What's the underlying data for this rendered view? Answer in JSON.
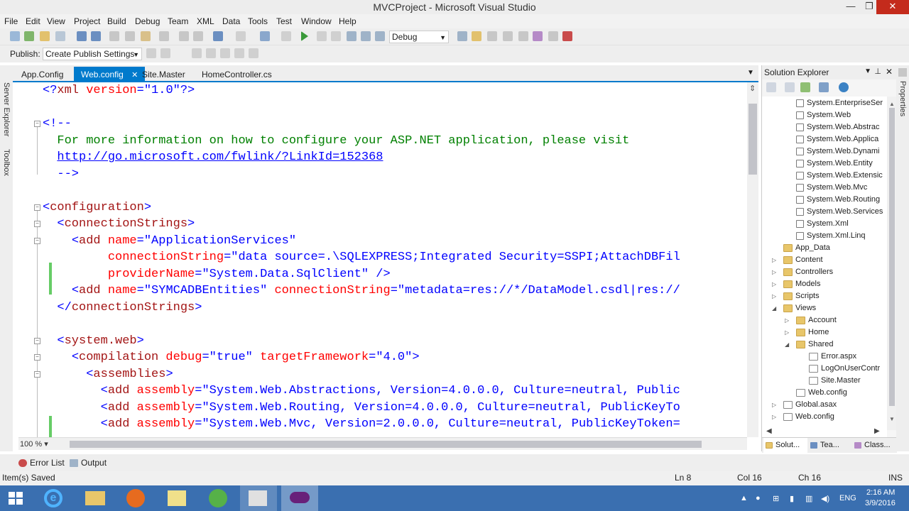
{
  "window": {
    "title": "MVCProject - Microsoft Visual Studio"
  },
  "menu": [
    "File",
    "Edit",
    "View",
    "Project",
    "Build",
    "Debug",
    "Team",
    "XML",
    "Data",
    "Tools",
    "Test",
    "Window",
    "Help"
  ],
  "toolbar": {
    "config_combo": "Debug",
    "publish_label": "Publish:",
    "publish_combo": "Create Publish Settings"
  },
  "left_strip": [
    "Server Explorer",
    "Toolbox"
  ],
  "tabs": [
    {
      "label": "App.Config",
      "active": false
    },
    {
      "label": "Web.config",
      "active": true
    },
    {
      "label": "Site.Master",
      "active": false
    },
    {
      "label": "HomeController.cs",
      "active": false
    }
  ],
  "editor": {
    "zoom": "100 %",
    "lines": [
      {
        "indent": "",
        "parts": [
          [
            "pun",
            "<?"
          ],
          [
            "tag",
            "xml"
          ],
          [
            "attr",
            " version"
          ],
          [
            "pun",
            "="
          ],
          [
            "val",
            "\"1.0\""
          ],
          [
            "pun",
            "?>"
          ]
        ]
      },
      {
        "indent": "",
        "parts": []
      },
      {
        "indent": "",
        "parts": [
          [
            "pun",
            "<!--"
          ]
        ]
      },
      {
        "indent": "  ",
        "parts": [
          [
            "cmt",
            "For more information on how to configure your ASP.NET application, please visit"
          ]
        ]
      },
      {
        "indent": "  ",
        "parts": [
          [
            "lnk",
            "http://go.microsoft.com/fwlink/?LinkId=152368"
          ]
        ]
      },
      {
        "indent": "  ",
        "parts": [
          [
            "pun",
            "-->"
          ]
        ]
      },
      {
        "indent": "",
        "parts": []
      },
      {
        "indent": "",
        "parts": [
          [
            "pun",
            "<"
          ],
          [
            "tag",
            "configuration"
          ],
          [
            "pun",
            ">"
          ]
        ]
      },
      {
        "indent": "  ",
        "parts": [
          [
            "pun",
            "<"
          ],
          [
            "tag",
            "connectionStrings"
          ],
          [
            "pun",
            ">"
          ]
        ]
      },
      {
        "indent": "    ",
        "parts": [
          [
            "pun",
            "<"
          ],
          [
            "tag",
            "add"
          ],
          [
            "attr",
            " name"
          ],
          [
            "pun",
            "="
          ],
          [
            "val",
            "\"ApplicationServices\""
          ]
        ]
      },
      {
        "indent": "         ",
        "parts": [
          [
            "attr",
            "connectionString"
          ],
          [
            "pun",
            "="
          ],
          [
            "val",
            "\"data source=.\\SQLEXPRESS;Integrated Security=SSPI;AttachDBFil"
          ]
        ]
      },
      {
        "indent": "         ",
        "parts": [
          [
            "attr",
            "providerName"
          ],
          [
            "pun",
            "="
          ],
          [
            "val",
            "\"System.Data.SqlClient\""
          ],
          [
            "pun",
            " />"
          ]
        ]
      },
      {
        "indent": "    ",
        "parts": [
          [
            "pun",
            "<"
          ],
          [
            "tag",
            "add"
          ],
          [
            "attr",
            " name"
          ],
          [
            "pun",
            "="
          ],
          [
            "val",
            "\"SYMCADBEntities\""
          ],
          [
            "attr",
            " connectionString"
          ],
          [
            "pun",
            "="
          ],
          [
            "val",
            "\"metadata=res://*/DataModel.csdl|res://"
          ]
        ]
      },
      {
        "indent": "  ",
        "parts": [
          [
            "pun",
            "</"
          ],
          [
            "tag",
            "connectionStrings"
          ],
          [
            "pun",
            ">"
          ]
        ]
      },
      {
        "indent": "",
        "parts": []
      },
      {
        "indent": "  ",
        "parts": [
          [
            "pun",
            "<"
          ],
          [
            "tag",
            "system.web"
          ],
          [
            "pun",
            ">"
          ]
        ]
      },
      {
        "indent": "    ",
        "parts": [
          [
            "pun",
            "<"
          ],
          [
            "tag",
            "compilation"
          ],
          [
            "attr",
            " debug"
          ],
          [
            "pun",
            "="
          ],
          [
            "val",
            "\"true\""
          ],
          [
            "attr",
            " targetFramework"
          ],
          [
            "pun",
            "="
          ],
          [
            "val",
            "\"4.0\""
          ],
          [
            "pun",
            ">"
          ]
        ]
      },
      {
        "indent": "      ",
        "parts": [
          [
            "pun",
            "<"
          ],
          [
            "tag",
            "assemblies"
          ],
          [
            "pun",
            ">"
          ]
        ]
      },
      {
        "indent": "        ",
        "parts": [
          [
            "pun",
            "<"
          ],
          [
            "tag",
            "add"
          ],
          [
            "attr",
            " assembly"
          ],
          [
            "pun",
            "="
          ],
          [
            "val",
            "\"System.Web.Abstractions, Version=4.0.0.0, Culture=neutral, Public"
          ]
        ]
      },
      {
        "indent": "        ",
        "parts": [
          [
            "pun",
            "<"
          ],
          [
            "tag",
            "add"
          ],
          [
            "attr",
            " assembly"
          ],
          [
            "pun",
            "="
          ],
          [
            "val",
            "\"System.Web.Routing, Version=4.0.0.0, Culture=neutral, PublicKeyTo"
          ]
        ]
      },
      {
        "indent": "        ",
        "parts": [
          [
            "pun",
            "<"
          ],
          [
            "tag",
            "add"
          ],
          [
            "attr",
            " assembly"
          ],
          [
            "pun",
            "="
          ],
          [
            "val",
            "\"System.Web.Mvc, Version=2.0.0.0, Culture=neutral, PublicKeyToken="
          ]
        ]
      }
    ]
  },
  "solution_explorer": {
    "title": "Solution Explorer",
    "items": [
      {
        "label": "System.EnterpriseSer",
        "kind": "ref",
        "level": 2
      },
      {
        "label": "System.Web",
        "kind": "ref",
        "level": 2
      },
      {
        "label": "System.Web.Abstrac",
        "kind": "ref",
        "level": 2
      },
      {
        "label": "System.Web.Applica",
        "kind": "ref",
        "level": 2
      },
      {
        "label": "System.Web.Dynami",
        "kind": "ref",
        "level": 2
      },
      {
        "label": "System.Web.Entity",
        "kind": "ref",
        "level": 2
      },
      {
        "label": "System.Web.Extensic",
        "kind": "ref",
        "level": 2
      },
      {
        "label": "System.Web.Mvc",
        "kind": "ref",
        "level": 2
      },
      {
        "label": "System.Web.Routing",
        "kind": "ref",
        "level": 2
      },
      {
        "label": "System.Web.Services",
        "kind": "ref",
        "level": 2
      },
      {
        "label": "System.Xml",
        "kind": "ref",
        "level": 2
      },
      {
        "label": "System.Xml.Linq",
        "kind": "ref",
        "level": 2
      },
      {
        "label": "App_Data",
        "kind": "folder",
        "level": 1,
        "arrow": ""
      },
      {
        "label": "Content",
        "kind": "folder",
        "level": 1,
        "arrow": "▷"
      },
      {
        "label": "Controllers",
        "kind": "folder",
        "level": 1,
        "arrow": "▷"
      },
      {
        "label": "Models",
        "kind": "folder",
        "level": 1,
        "arrow": "▷"
      },
      {
        "label": "Scripts",
        "kind": "folder",
        "level": 1,
        "arrow": "▷"
      },
      {
        "label": "Views",
        "kind": "folder",
        "level": 1,
        "arrow": "◢"
      },
      {
        "label": "Account",
        "kind": "folder",
        "level": 2,
        "arrow": "▷"
      },
      {
        "label": "Home",
        "kind": "folder",
        "level": 2,
        "arrow": "▷"
      },
      {
        "label": "Shared",
        "kind": "folder",
        "level": 2,
        "arrow": "◢"
      },
      {
        "label": "Error.aspx",
        "kind": "file",
        "level": 3
      },
      {
        "label": "LogOnUserContr",
        "kind": "file",
        "level": 3
      },
      {
        "label": "Site.Master",
        "kind": "file",
        "level": 3
      },
      {
        "label": "Web.config",
        "kind": "file",
        "level": 2
      },
      {
        "label": "Global.asax",
        "kind": "file",
        "level": 1,
        "arrow": "▷"
      },
      {
        "label": "Web.config",
        "kind": "file",
        "level": 1,
        "arrow": "▷"
      }
    ],
    "bottom_tabs": [
      "Solut...",
      "Tea...",
      "Class..."
    ]
  },
  "right_strip": [
    "Properties"
  ],
  "bottom_panel": [
    "Error List",
    "Output"
  ],
  "status": {
    "message": "Item(s) Saved",
    "ln": "Ln 8",
    "col": "Col 16",
    "ch": "Ch 16",
    "mode": "INS"
  },
  "taskbar": {
    "lang": "ENG",
    "time": "2:16 AM",
    "date": "3/9/2016"
  },
  "colors": {
    "accent": "#007acc",
    "tag": "#a31515",
    "attr": "#ff0000",
    "val": "#0000ff",
    "cmt": "#008000"
  }
}
